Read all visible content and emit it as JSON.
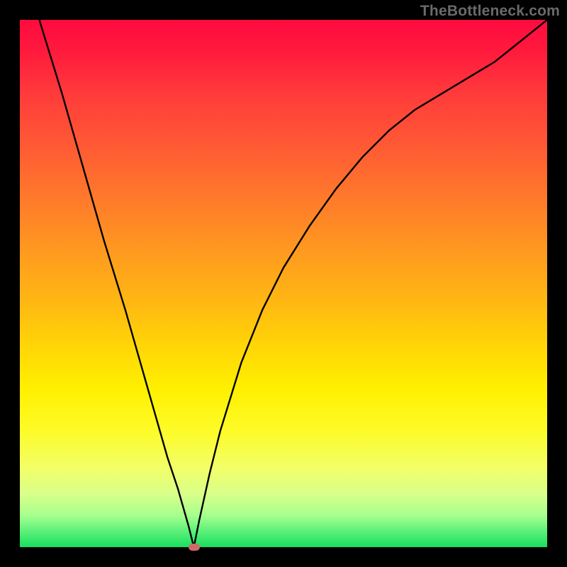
{
  "watermark": "TheBottleneck.com",
  "chart_data": {
    "type": "line",
    "title": "",
    "xlabel": "",
    "ylabel": "",
    "xlim": [
      0,
      100
    ],
    "ylim": [
      0,
      100
    ],
    "grid": false,
    "legend": false,
    "min_marker": {
      "x": 33,
      "y": 0
    },
    "series": [
      {
        "name": "curve",
        "x": [
          0,
          4,
          8,
          12,
          16,
          20,
          24,
          28,
          30,
          32,
          33,
          34,
          36,
          38,
          42,
          46,
          50,
          55,
          60,
          65,
          70,
          75,
          80,
          85,
          90,
          95,
          100
        ],
        "y": [
          113,
          99,
          86,
          72,
          58,
          45,
          31,
          17,
          11,
          4,
          0,
          5,
          14,
          22,
          35,
          45,
          53,
          61,
          68,
          74,
          79,
          83,
          86,
          89,
          92,
          96,
          100
        ]
      }
    ]
  }
}
